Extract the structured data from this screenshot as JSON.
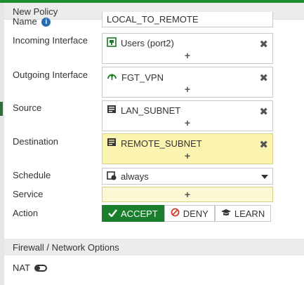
{
  "header": {
    "title": "New Policy"
  },
  "fields": {
    "name": {
      "label": "Name",
      "value": "LOCAL_TO_REMOTE"
    },
    "incoming": {
      "label": "Incoming Interface",
      "entry": "Users (port2)",
      "icon": "network-port-icon",
      "add": "+",
      "remove": "✖"
    },
    "outgoing": {
      "label": "Outgoing Interface",
      "entry": "FGT_VPN",
      "icon": "vpn-tunnel-icon",
      "add": "+",
      "remove": "✖"
    },
    "source": {
      "label": "Source",
      "entry": "LAN_SUBNET",
      "icon": "address-object-icon",
      "add": "+",
      "remove": "✖"
    },
    "destination": {
      "label": "Destination",
      "entry": "REMOTE_SUBNET",
      "icon": "address-object-icon",
      "add": "+",
      "remove": "✖"
    },
    "schedule": {
      "label": "Schedule",
      "value": "always",
      "icon": "schedule-icon"
    },
    "service": {
      "label": "Service",
      "add": "+"
    },
    "action": {
      "label": "Action",
      "buttons": [
        {
          "label": "ACCEPT",
          "icon": "check-icon",
          "selected": true
        },
        {
          "label": "DENY",
          "icon": "deny-icon",
          "selected": false
        },
        {
          "label": "LEARN",
          "icon": "graduation-cap-icon",
          "selected": false
        }
      ]
    }
  },
  "section": {
    "title": "Firewall / Network Options"
  },
  "nat": {
    "label": "NAT",
    "enabled": false
  },
  "colors": {
    "accent": "#1a7f2c",
    "highlight": "#fbf3b0",
    "topbar": "#1e8c2d"
  }
}
